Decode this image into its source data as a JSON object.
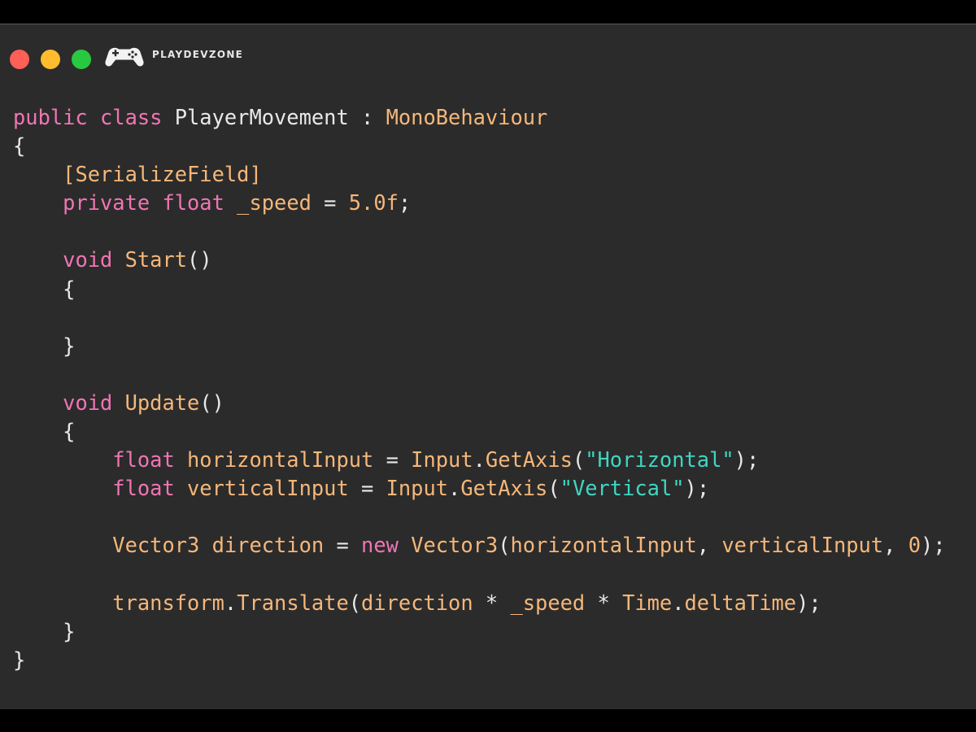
{
  "brand": {
    "name": "PLAYDEVZONE",
    "logo_icon": "gamepad-icon"
  },
  "window_controls": {
    "close_color": "#ff5f57",
    "minimize_color": "#febc2e",
    "maximize_color": "#28c840"
  },
  "colors": {
    "background": "#2b2b2b",
    "keyword": "#f075b4",
    "type_function": "#f5b77a",
    "string": "#3fd6c2",
    "plain": "#e8e8e8"
  },
  "code_lines": [
    [
      [
        "kw",
        "public class "
      ],
      [
        "pl",
        "PlayerMovement : "
      ],
      [
        "fn",
        "MonoBehaviour"
      ]
    ],
    [
      [
        "pl",
        "{"
      ]
    ],
    [
      [
        "pl",
        "    "
      ],
      [
        "fn",
        "[SerializeField]"
      ]
    ],
    [
      [
        "pl",
        "    "
      ],
      [
        "kw",
        "private float "
      ],
      [
        "fn",
        "_speed"
      ],
      [
        "pl",
        " = "
      ],
      [
        "fn",
        "5.0f"
      ],
      [
        "pl",
        ";"
      ]
    ],
    [],
    [
      [
        "pl",
        "    "
      ],
      [
        "kw",
        "void "
      ],
      [
        "fn",
        "Start"
      ],
      [
        "pl",
        "()"
      ]
    ],
    [
      [
        "pl",
        "    {"
      ]
    ],
    [],
    [
      [
        "pl",
        "    }"
      ]
    ],
    [],
    [
      [
        "pl",
        "    "
      ],
      [
        "kw",
        "void "
      ],
      [
        "fn",
        "Update"
      ],
      [
        "pl",
        "()"
      ]
    ],
    [
      [
        "pl",
        "    {"
      ]
    ],
    [
      [
        "pl",
        "        "
      ],
      [
        "kw",
        "float "
      ],
      [
        "fn",
        "horizontalInput"
      ],
      [
        "pl",
        " = "
      ],
      [
        "fn",
        "Input"
      ],
      [
        "pl",
        "."
      ],
      [
        "fn",
        "GetAxis"
      ],
      [
        "pl",
        "("
      ],
      [
        "str",
        "\"Horizontal\""
      ],
      [
        "pl",
        ");"
      ]
    ],
    [
      [
        "pl",
        "        "
      ],
      [
        "kw",
        "float "
      ],
      [
        "fn",
        "verticalInput"
      ],
      [
        "pl",
        " = "
      ],
      [
        "fn",
        "Input"
      ],
      [
        "pl",
        "."
      ],
      [
        "fn",
        "GetAxis"
      ],
      [
        "pl",
        "("
      ],
      [
        "str",
        "\"Vertical\""
      ],
      [
        "pl",
        ");"
      ]
    ],
    [],
    [
      [
        "pl",
        "        "
      ],
      [
        "fn",
        "Vector3 direction"
      ],
      [
        "pl",
        " = "
      ],
      [
        "kw",
        "new "
      ],
      [
        "fn",
        "Vector3"
      ],
      [
        "pl",
        "("
      ],
      [
        "fn",
        "horizontalInput"
      ],
      [
        "pl",
        ", "
      ],
      [
        "fn",
        "verticalInput"
      ],
      [
        "pl",
        ", "
      ],
      [
        "fn",
        "0"
      ],
      [
        "pl",
        ");"
      ]
    ],
    [],
    [
      [
        "pl",
        "        "
      ],
      [
        "fn",
        "transform"
      ],
      [
        "pl",
        "."
      ],
      [
        "fn",
        "Translate"
      ],
      [
        "pl",
        "("
      ],
      [
        "fn",
        "direction"
      ],
      [
        "pl",
        " * "
      ],
      [
        "fn",
        "_speed"
      ],
      [
        "pl",
        " * "
      ],
      [
        "fn",
        "Time"
      ],
      [
        "pl",
        "."
      ],
      [
        "fn",
        "deltaTime"
      ],
      [
        "pl",
        ");"
      ]
    ],
    [
      [
        "pl",
        "    }"
      ]
    ],
    [
      [
        "pl",
        "}"
      ]
    ]
  ]
}
